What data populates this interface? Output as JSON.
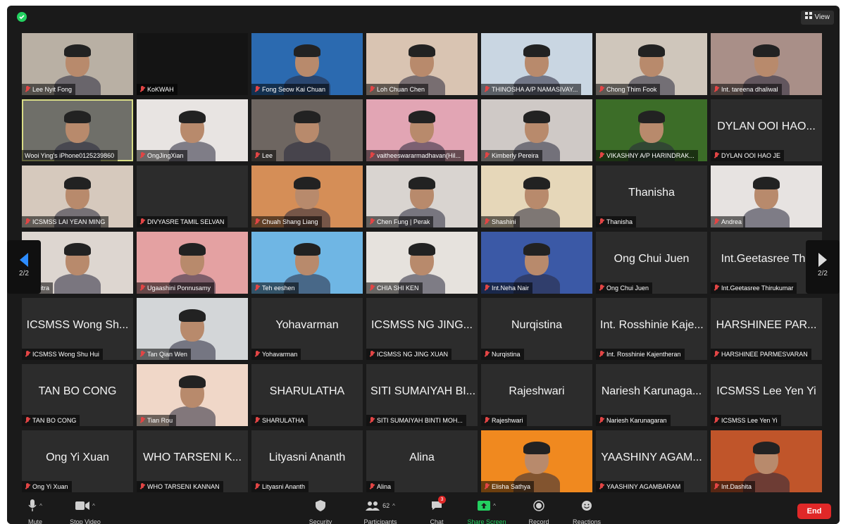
{
  "view_label": "View",
  "page_indicator": "2/2",
  "participants": [
    {
      "tag": "Lee Nyit Fong",
      "big": null,
      "bg": "#b9b0a4"
    },
    {
      "tag": "KoKWAH",
      "big": null,
      "bg": "#141414"
    },
    {
      "tag": "Fong Seow Kai Chuan",
      "big": null,
      "bg": "#2b6ab0"
    },
    {
      "tag": "Loh Chuan Chen",
      "big": null,
      "bg": "#d9c4b2"
    },
    {
      "tag": "THINOSHA A/P NAMASIVAY...",
      "big": null,
      "bg": "#c9d6e2"
    },
    {
      "tag": "Chong Thim Fook",
      "big": null,
      "bg": "#cfc6bb"
    },
    {
      "tag": "Int. tareena dhaliwal",
      "big": null,
      "bg": "#a98f88"
    },
    {
      "tag": "Wooi Ying's iPhone0125239860",
      "big": null,
      "bg": "#6f6f69"
    },
    {
      "tag": "OngJingXian",
      "big": null,
      "bg": "#e8e4e2"
    },
    {
      "tag": "Lee",
      "big": null,
      "bg": "#6e6661"
    },
    {
      "tag": "vaitheeswararmadhavan(Hil...",
      "big": null,
      "bg": "#e2a5b4"
    },
    {
      "tag": "Kimberly Pereira",
      "big": null,
      "bg": "#cfc9c6"
    },
    {
      "tag": "VIKASHNY A/P HARINDRAK...",
      "big": null,
      "bg": "#3c6d28"
    },
    {
      "tag": "DYLAN OOI HAO JE",
      "big": "DYLAN OOI HAO...",
      "bg": "#2c2c2c"
    },
    {
      "tag": "ICSMSS LAI YEAN MING",
      "big": null,
      "bg": "#d6c9bd"
    },
    {
      "tag": "DIVYASRE TAMIL SELVAN",
      "big": null,
      "bg": "#2c2c2c"
    },
    {
      "tag": "Chuah Shang Liang",
      "big": null,
      "bg": "#d58e57"
    },
    {
      "tag": "Chen Fung | Perak",
      "big": null,
      "bg": "#d9d4d0"
    },
    {
      "tag": "Shashini",
      "big": null,
      "bg": "#e6d7b9"
    },
    {
      "tag": "Thanisha",
      "big": "Thanisha",
      "bg": "#2c2c2c"
    },
    {
      "tag": "Andrea",
      "big": null,
      "bg": "#e7e3e1"
    },
    {
      "tag": "Chitra",
      "big": null,
      "bg": "#ddd6d0"
    },
    {
      "tag": "Ugaashini Ponnusamy",
      "big": null,
      "bg": "#e4a1a2"
    },
    {
      "tag": "Teh eeshen",
      "big": null,
      "bg": "#6fb6e4"
    },
    {
      "tag": "CHIA SHI KEN",
      "big": null,
      "bg": "#e6e2dd"
    },
    {
      "tag": "Int.Neha Nair",
      "big": null,
      "bg": "#3b59a6"
    },
    {
      "tag": "Ong Chui Juen",
      "big": "Ong Chui Juen",
      "bg": "#2c2c2c"
    },
    {
      "tag": "Int.Geetasree Thirukumar",
      "big": "Int.Geetasree Thir",
      "bg": "#2c2c2c"
    },
    {
      "tag": "ICSMSS Wong Shu Hui",
      "big": "ICSMSS Wong Sh...",
      "bg": "#2c2c2c"
    },
    {
      "tag": "Tan Qian Wen",
      "big": null,
      "bg": "#d3d6d8"
    },
    {
      "tag": "Yohavarman",
      "big": "Yohavarman",
      "bg": "#2c2c2c"
    },
    {
      "tag": "ICSMSS NG JING XUAN",
      "big": "ICSMSS NG JING...",
      "bg": "#2c2c2c"
    },
    {
      "tag": "Nurqistina",
      "big": "Nurqistina",
      "bg": "#2c2c2c"
    },
    {
      "tag": "Int. Rosshinie Kajentheran",
      "big": "Int. Rosshinie Kaje...",
      "bg": "#2c2c2c"
    },
    {
      "tag": "HARSHINEE PARMESVARAN",
      "big": "HARSHINEE PAR...",
      "bg": "#2c2c2c"
    },
    {
      "tag": "TAN BO CONG",
      "big": "TAN BO CONG",
      "bg": "#2c2c2c"
    },
    {
      "tag": "Tian Rou",
      "big": null,
      "bg": "#f0d7c8"
    },
    {
      "tag": "SHARULATHA",
      "big": "SHARULATHA",
      "bg": "#2c2c2c"
    },
    {
      "tag": "SITI SUMAIYAH BINTI MOH...",
      "big": "SITI SUMAIYAH BI...",
      "bg": "#2c2c2c"
    },
    {
      "tag": "Rajeshwari",
      "big": "Rajeshwari",
      "bg": "#2c2c2c"
    },
    {
      "tag": "Nariesh Karunagaran",
      "big": "Nariesh Karunaga...",
      "bg": "#2c2c2c"
    },
    {
      "tag": "ICSMSS Lee Yen Yi",
      "big": "ICSMSS Lee Yen Yi",
      "bg": "#2c2c2c"
    },
    {
      "tag": "Ong Yi Xuan",
      "big": "Ong Yi Xuan",
      "bg": "#2c2c2c"
    },
    {
      "tag": "WHO TARSENI KANNAN",
      "big": "WHO TARSENI K...",
      "bg": "#2c2c2c"
    },
    {
      "tag": "Lityasni Ananth",
      "big": "Lityasni Ananth",
      "bg": "#2c2c2c"
    },
    {
      "tag": "Alina",
      "big": "Alina",
      "bg": "#2c2c2c"
    },
    {
      "tag": "Elisha Sathya",
      "big": null,
      "bg": "#f0891f"
    },
    {
      "tag": "YAASHINY AGAMBARAM",
      "big": "YAASHINY AGAM...",
      "bg": "#2c2c2c"
    },
    {
      "tag": "Int.Dashita",
      "big": null,
      "bg": "#c0552a"
    }
  ],
  "toolbar": {
    "mute": "Mute",
    "stop_video": "Stop Video",
    "security": "Security",
    "participants": "Participants",
    "participants_count": "62",
    "chat": "Chat",
    "chat_badge": "3",
    "share_screen": "Share Screen",
    "record": "Record",
    "reactions": "Reactions",
    "end": "End"
  },
  "colors": {
    "share_green": "#23d160",
    "end_red": "#e02828",
    "active_border": "#d8dc86",
    "nav_blue": "#2d8cff"
  }
}
